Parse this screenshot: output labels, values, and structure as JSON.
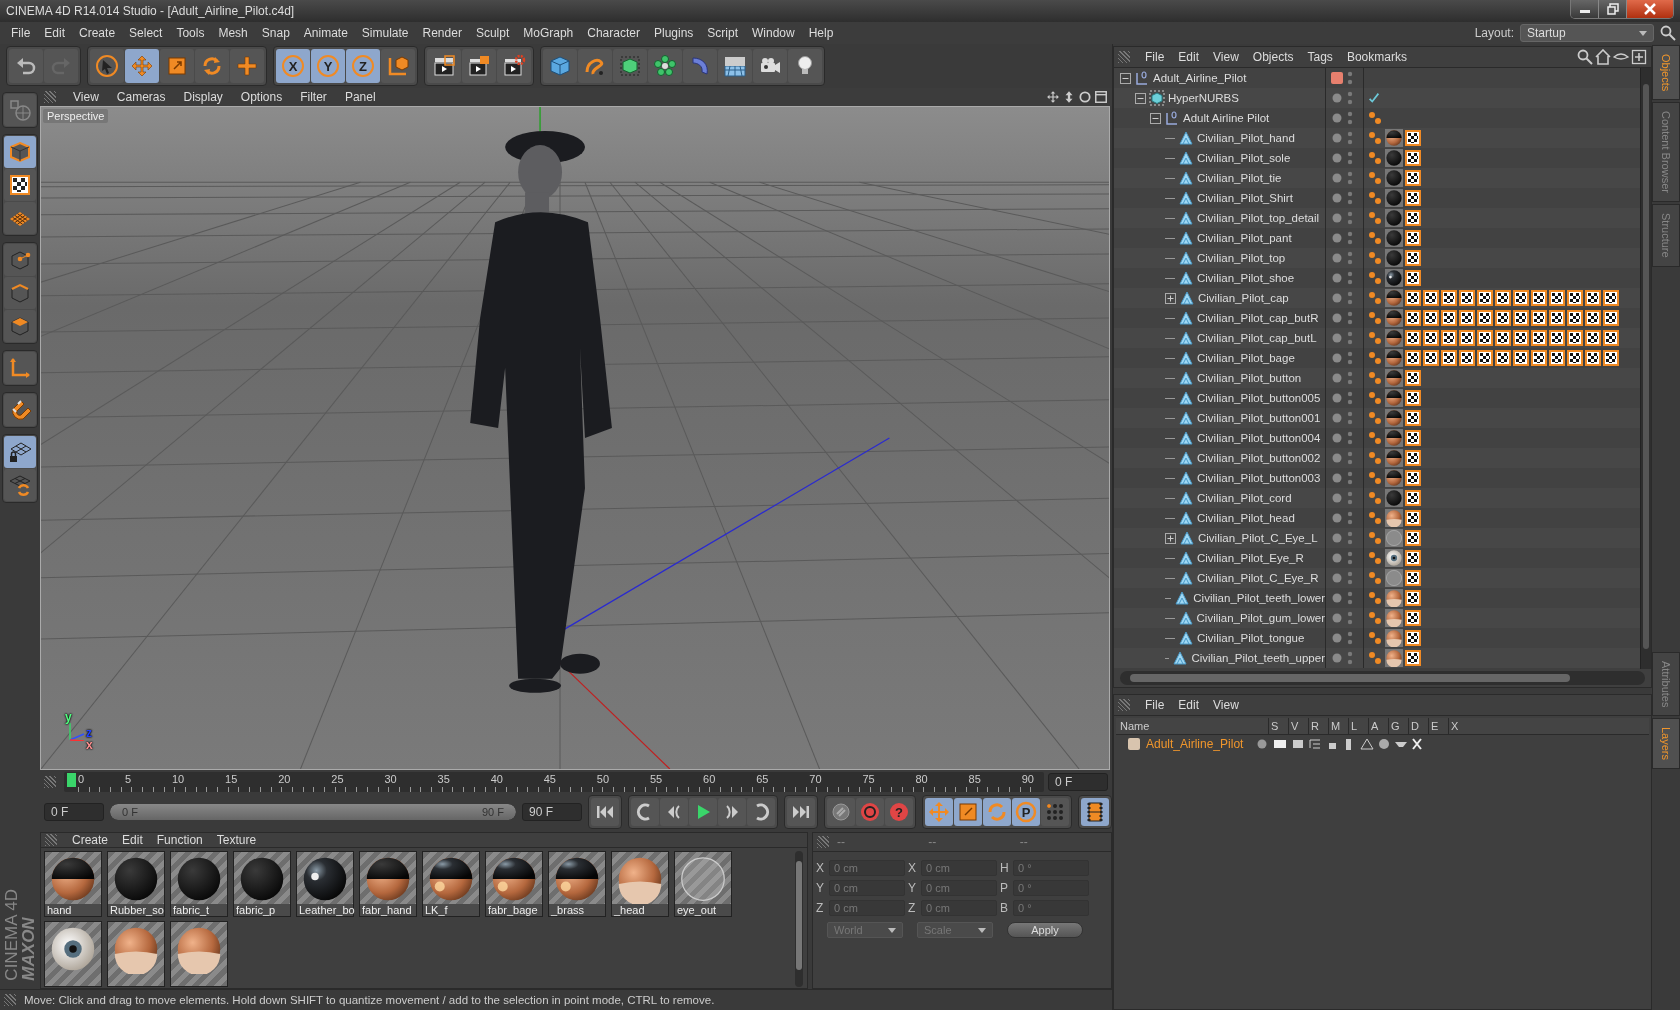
{
  "window": {
    "title": "CINEMA 4D R14.014 Studio - [Adult_Airline_Pilot.c4d]"
  },
  "menu": [
    "File",
    "Edit",
    "Create",
    "Select",
    "Tools",
    "Mesh",
    "Snap",
    "Animate",
    "Simulate",
    "Render",
    "Sculpt",
    "MoGraph",
    "Character",
    "Plugins",
    "Script",
    "Window",
    "Help"
  ],
  "layout": {
    "label": "Layout:",
    "value": "Startup"
  },
  "toolbar": [
    [
      {
        "kind": "undo",
        "selected": false
      },
      {
        "kind": "redo",
        "selected": false
      }
    ],
    [
      {
        "kind": "live-select",
        "selected": false
      },
      {
        "kind": "move",
        "selected": true
      },
      {
        "kind": "scale",
        "selected": false
      },
      {
        "kind": "rotate",
        "selected": false
      },
      {
        "kind": "add",
        "selected": false
      }
    ],
    [
      {
        "kind": "axis-lock",
        "label": "X",
        "selected": true
      },
      {
        "kind": "axis-lock",
        "label": "Y",
        "selected": true
      },
      {
        "kind": "axis-lock",
        "label": "Z",
        "selected": true
      },
      {
        "kind": "world",
        "selected": false
      }
    ],
    [
      {
        "kind": "render-view",
        "selected": false
      },
      {
        "kind": "render-picture",
        "selected": false
      },
      {
        "kind": "render-settings",
        "selected": false
      }
    ],
    [
      {
        "kind": "cube",
        "selected": false
      },
      {
        "kind": "spline",
        "selected": false
      },
      {
        "kind": "nurbs",
        "selected": false
      },
      {
        "kind": "cloner",
        "selected": false
      },
      {
        "kind": "deformer",
        "selected": false
      },
      {
        "kind": "floor",
        "selected": false
      },
      {
        "kind": "camera",
        "selected": false
      },
      {
        "kind": "light",
        "selected": false
      }
    ]
  ],
  "left_toolbar": [
    [
      {
        "kind": "make-editable",
        "selected": false
      }
    ],
    [
      {
        "kind": "model",
        "selected": true
      },
      {
        "kind": "texture",
        "selected": false
      },
      {
        "kind": "workplane",
        "selected": false
      }
    ],
    [
      {
        "kind": "points",
        "selected": false
      },
      {
        "kind": "edges",
        "selected": false
      },
      {
        "kind": "polygons",
        "selected": false
      }
    ],
    [
      {
        "kind": "axis",
        "selected": false
      }
    ],
    [
      {
        "kind": "magnet",
        "selected": false
      }
    ],
    [
      {
        "kind": "lock-grid",
        "selected": true
      },
      {
        "kind": "sync-grid",
        "selected": false
      }
    ]
  ],
  "branding": {
    "brand": "MAXON",
    "product": "CINEMA 4D"
  },
  "viewport": {
    "menu": [
      "View",
      "Cameras",
      "Display",
      "Options",
      "Filter",
      "Panel"
    ],
    "label": "Perspective",
    "gizmo_labels": [
      "y",
      "z",
      "x"
    ]
  },
  "timeline": {
    "ticks": [
      "0",
      "5",
      "10",
      "15",
      "20",
      "25",
      "30",
      "35",
      "40",
      "45",
      "50",
      "55",
      "60",
      "65",
      "70",
      "75",
      "80",
      "85",
      "90"
    ],
    "current_frame": "0 F"
  },
  "transport": {
    "start_field": "0 F",
    "range_start": "0 F",
    "range_end": "90 F",
    "level": 1,
    "end_field": "90 F",
    "buttons": [
      [
        {
          "kind": "first",
          "selected": false
        }
      ],
      [
        {
          "kind": "loop-back",
          "selected": false
        },
        {
          "kind": "prev-key",
          "selected": false
        },
        {
          "kind": "play",
          "selected": false
        },
        {
          "kind": "next-key",
          "selected": false
        },
        {
          "kind": "loop-forward",
          "selected": false
        }
      ],
      [
        {
          "kind": "last",
          "selected": false
        }
      ],
      [
        {
          "kind": "record",
          "selected": false
        },
        {
          "kind": "autokey",
          "selected": false
        },
        {
          "kind": "help-key",
          "label": "?",
          "selected": false
        }
      ],
      [
        {
          "kind": "key-move",
          "selected": true
        },
        {
          "kind": "key-scale",
          "selected": true
        },
        {
          "kind": "key-rotate",
          "selected": true
        },
        {
          "kind": "key-param",
          "label": "P",
          "selected": true
        },
        {
          "kind": "key-pla",
          "selected": false
        }
      ],
      [
        {
          "kind": "timeline-window",
          "selected": true
        }
      ]
    ]
  },
  "materials": {
    "menu": [
      "Create",
      "Edit",
      "Function",
      "Texture"
    ],
    "items": [
      {
        "name": "hand",
        "kind": "split"
      },
      {
        "name": "Rubber_so",
        "kind": "black"
      },
      {
        "name": "fabric_t",
        "kind": "black"
      },
      {
        "name": "fabric_p",
        "kind": "black"
      },
      {
        "name": "Leather_bo",
        "kind": "glossy"
      },
      {
        "name": "fabr_hand",
        "kind": "split"
      },
      {
        "name": "LK_f",
        "kind": "split-glossy"
      },
      {
        "name": "fabr_bage",
        "kind": "split-glossy"
      },
      {
        "name": "_brass",
        "kind": "split-glossy"
      },
      {
        "name": "_head",
        "kind": "skin"
      },
      {
        "name": "eye_out",
        "kind": "glass"
      },
      {
        "kind": "eye"
      },
      {
        "kind": "skin"
      },
      {
        "kind": "skin"
      }
    ]
  },
  "coordinates": {
    "headers": [
      "--",
      "--",
      "--"
    ],
    "rows": [
      {
        "pos_axis": "X",
        "position": "0 cm",
        "size_axis": "X",
        "size": "0 cm",
        "rot_axis": "H",
        "rotation": "0 °"
      },
      {
        "pos_axis": "Y",
        "position": "0 cm",
        "size_axis": "Y",
        "size": "0 cm",
        "rot_axis": "P",
        "rotation": "0 °"
      },
      {
        "pos_axis": "Z",
        "position": "0 cm",
        "size_axis": "Z",
        "size": "0 cm",
        "rot_axis": "B",
        "rotation": "0 °"
      }
    ],
    "mode": "World",
    "size_mode": "Scale",
    "apply": "Apply"
  },
  "status_bar": "Move: Click and drag to move elements. Hold down SHIFT to quantize movement / add to the selection in point mode, CTRL to remove.",
  "object_manager": {
    "menu": [
      "File",
      "Edit",
      "View",
      "Objects",
      "Tags",
      "Bookmarks"
    ],
    "objects": [
      {
        "name": "Adult_Airline_Pilot",
        "kind": "null",
        "expanded": true,
        "color": "#e8806e",
        "children": [
          {
            "name": "HyperNURBS",
            "kind": "hypernurbs",
            "expanded": true,
            "tags": [
              {
                "kind": "check"
              }
            ],
            "children": [
              {
                "name": "Adult Airline Pilot",
                "kind": "null",
                "expanded": true,
                "tags": [
                  {
                    "kind": "phong"
                  }
                ],
                "children": [
                  {
                    "name": "Civilian_Pilot_hand",
                    "kind": "polygon",
                    "tags": [
                      {
                        "kind": "phong"
                      },
                      {
                        "kind": "mat-split"
                      },
                      {
                        "kind": "texture"
                      }
                    ]
                  },
                  {
                    "name": "Civilian_Pilot_sole",
                    "kind": "polygon",
                    "tags": [
                      {
                        "kind": "phong"
                      },
                      {
                        "kind": "mat-black"
                      },
                      {
                        "kind": "texture"
                      }
                    ]
                  },
                  {
                    "name": "Civilian_Pilot_tie",
                    "kind": "polygon",
                    "tags": [
                      {
                        "kind": "phong"
                      },
                      {
                        "kind": "mat-black"
                      },
                      {
                        "kind": "texture"
                      }
                    ]
                  },
                  {
                    "name": "Civilian_Pilot_Shirt",
                    "kind": "polygon",
                    "tags": [
                      {
                        "kind": "phong"
                      },
                      {
                        "kind": "mat-black"
                      },
                      {
                        "kind": "texture"
                      }
                    ]
                  },
                  {
                    "name": "Civilian_Pilot_top_detail",
                    "kind": "polygon",
                    "tags": [
                      {
                        "kind": "phong"
                      },
                      {
                        "kind": "mat-black"
                      },
                      {
                        "kind": "texture"
                      }
                    ]
                  },
                  {
                    "name": "Civilian_Pilot_pant",
                    "kind": "polygon",
                    "tags": [
                      {
                        "kind": "phong"
                      },
                      {
                        "kind": "mat-black"
                      },
                      {
                        "kind": "texture"
                      }
                    ]
                  },
                  {
                    "name": "Civilian_Pilot_top",
                    "kind": "polygon",
                    "tags": [
                      {
                        "kind": "phong"
                      },
                      {
                        "kind": "mat-black"
                      },
                      {
                        "kind": "texture"
                      }
                    ]
                  },
                  {
                    "name": "Civilian_Pilot_shoe",
                    "kind": "polygon",
                    "tags": [
                      {
                        "kind": "phong"
                      },
                      {
                        "kind": "mat-glossy"
                      },
                      {
                        "kind": "texture"
                      }
                    ]
                  },
                  {
                    "name": "Civilian_Pilot_cap",
                    "kind": "polygon",
                    "expanded": false,
                    "tags": [
                      {
                        "kind": "phong"
                      },
                      {
                        "kind": "mat-split"
                      },
                      {
                        "kind": "texture"
                      },
                      {
                        "kind": "texture"
                      },
                      {
                        "kind": "texture"
                      },
                      {
                        "kind": "texture"
                      },
                      {
                        "kind": "texture"
                      },
                      {
                        "kind": "texture"
                      },
                      {
                        "kind": "texture"
                      },
                      {
                        "kind": "texture"
                      },
                      {
                        "kind": "texture"
                      },
                      {
                        "kind": "texture"
                      },
                      {
                        "kind": "texture"
                      },
                      {
                        "kind": "texture"
                      }
                    ]
                  },
                  {
                    "name": "Civilian_Pilot_cap_butR",
                    "kind": "polygon",
                    "tags": [
                      {
                        "kind": "phong"
                      },
                      {
                        "kind": "mat-split"
                      },
                      {
                        "kind": "texture"
                      },
                      {
                        "kind": "texture"
                      },
                      {
                        "kind": "texture"
                      },
                      {
                        "kind": "texture"
                      },
                      {
                        "kind": "texture"
                      },
                      {
                        "kind": "texture"
                      },
                      {
                        "kind": "texture"
                      },
                      {
                        "kind": "texture"
                      },
                      {
                        "kind": "texture"
                      },
                      {
                        "kind": "texture"
                      },
                      {
                        "kind": "texture"
                      },
                      {
                        "kind": "texture"
                      }
                    ]
                  },
                  {
                    "name": "Civilian_Pilot_cap_butL",
                    "kind": "polygon",
                    "tags": [
                      {
                        "kind": "phong"
                      },
                      {
                        "kind": "mat-split"
                      },
                      {
                        "kind": "texture"
                      },
                      {
                        "kind": "texture"
                      },
                      {
                        "kind": "texture"
                      },
                      {
                        "kind": "texture"
                      },
                      {
                        "kind": "texture"
                      },
                      {
                        "kind": "texture"
                      },
                      {
                        "kind": "texture"
                      },
                      {
                        "kind": "texture"
                      },
                      {
                        "kind": "texture"
                      },
                      {
                        "kind": "texture"
                      },
                      {
                        "kind": "texture"
                      },
                      {
                        "kind": "texture"
                      }
                    ]
                  },
                  {
                    "name": "Civilian_Pilot_bage",
                    "kind": "polygon",
                    "tags": [
                      {
                        "kind": "phong"
                      },
                      {
                        "kind": "mat-split"
                      },
                      {
                        "kind": "texture"
                      },
                      {
                        "kind": "texture"
                      },
                      {
                        "kind": "texture"
                      },
                      {
                        "kind": "texture"
                      },
                      {
                        "kind": "texture"
                      },
                      {
                        "kind": "texture"
                      },
                      {
                        "kind": "texture"
                      },
                      {
                        "kind": "texture"
                      },
                      {
                        "kind": "texture"
                      },
                      {
                        "kind": "texture"
                      },
                      {
                        "kind": "texture"
                      },
                      {
                        "kind": "texture"
                      }
                    ]
                  },
                  {
                    "name": "Civilian_Pilot_button",
                    "kind": "polygon",
                    "tags": [
                      {
                        "kind": "phong"
                      },
                      {
                        "kind": "mat-split"
                      },
                      {
                        "kind": "texture"
                      }
                    ]
                  },
                  {
                    "name": "Civilian_Pilot_button005",
                    "kind": "polygon",
                    "tags": [
                      {
                        "kind": "phong"
                      },
                      {
                        "kind": "mat-split"
                      },
                      {
                        "kind": "texture"
                      }
                    ]
                  },
                  {
                    "name": "Civilian_Pilot_button001",
                    "kind": "polygon",
                    "tags": [
                      {
                        "kind": "phong"
                      },
                      {
                        "kind": "mat-split"
                      },
                      {
                        "kind": "texture"
                      }
                    ]
                  },
                  {
                    "name": "Civilian_Pilot_button004",
                    "kind": "polygon",
                    "tags": [
                      {
                        "kind": "phong"
                      },
                      {
                        "kind": "mat-split"
                      },
                      {
                        "kind": "texture"
                      }
                    ]
                  },
                  {
                    "name": "Civilian_Pilot_button002",
                    "kind": "polygon",
                    "tags": [
                      {
                        "kind": "phong"
                      },
                      {
                        "kind": "mat-split"
                      },
                      {
                        "kind": "texture"
                      }
                    ]
                  },
                  {
                    "name": "Civilian_Pilot_button003",
                    "kind": "polygon",
                    "tags": [
                      {
                        "kind": "phong"
                      },
                      {
                        "kind": "mat-split"
                      },
                      {
                        "kind": "texture"
                      }
                    ]
                  },
                  {
                    "name": "Civilian_Pilot_cord",
                    "kind": "polygon",
                    "tags": [
                      {
                        "kind": "phong"
                      },
                      {
                        "kind": "mat-black"
                      },
                      {
                        "kind": "texture"
                      }
                    ]
                  },
                  {
                    "name": "Civilian_Pilot_head",
                    "kind": "polygon",
                    "tags": [
                      {
                        "kind": "phong"
                      },
                      {
                        "kind": "mat-skin"
                      },
                      {
                        "kind": "texture"
                      }
                    ]
                  },
                  {
                    "name": "Civilian_Pilot_C_Eye_L",
                    "kind": "polygon",
                    "expanded": false,
                    "tags": [
                      {
                        "kind": "phong"
                      },
                      {
                        "kind": "mat-glass"
                      },
                      {
                        "kind": "texture"
                      }
                    ]
                  },
                  {
                    "name": "Civilian_Pilot_Eye_R",
                    "kind": "polygon",
                    "tags": [
                      {
                        "kind": "phong"
                      },
                      {
                        "kind": "mat-eye"
                      },
                      {
                        "kind": "texture"
                      }
                    ]
                  },
                  {
                    "name": "Civilian_Pilot_C_Eye_R",
                    "kind": "polygon",
                    "tags": [
                      {
                        "kind": "phong"
                      },
                      {
                        "kind": "mat-glass"
                      },
                      {
                        "kind": "texture"
                      }
                    ]
                  },
                  {
                    "name": "Civilian_Pilot_teeth_lower",
                    "kind": "polygon",
                    "tags": [
                      {
                        "kind": "phong"
                      },
                      {
                        "kind": "mat-skin"
                      },
                      {
                        "kind": "texture"
                      }
                    ]
                  },
                  {
                    "name": "Civilian_Pilot_gum_lower",
                    "kind": "polygon",
                    "tags": [
                      {
                        "kind": "phong"
                      },
                      {
                        "kind": "mat-skin"
                      },
                      {
                        "kind": "texture"
                      }
                    ]
                  },
                  {
                    "name": "Civilian_Pilot_tongue",
                    "kind": "polygon",
                    "tags": [
                      {
                        "kind": "phong"
                      },
                      {
                        "kind": "mat-skin"
                      },
                      {
                        "kind": "texture"
                      }
                    ]
                  },
                  {
                    "name": "Civilian_Pilot_teeth_upper",
                    "kind": "polygon",
                    "tags": [
                      {
                        "kind": "phong"
                      },
                      {
                        "kind": "mat-skin"
                      },
                      {
                        "kind": "texture"
                      }
                    ]
                  }
                ]
              }
            ]
          }
        ]
      }
    ]
  },
  "side_tabs_top": [
    {
      "label": "Objects",
      "selected": true
    },
    {
      "label": "Content Browser",
      "selected": false
    },
    {
      "label": "Structure",
      "selected": false
    }
  ],
  "layer_manager": {
    "menu": [
      "File",
      "Edit",
      "View"
    ],
    "columns": [
      "Name",
      "S",
      "V",
      "R",
      "M",
      "L",
      "A",
      "G",
      "D",
      "E",
      "X"
    ],
    "layers": [
      {
        "name": "Adult_Airline_Pilot",
        "color": "#d8c4ae"
      }
    ]
  },
  "side_tabs_bottom": [
    {
      "label": "Attributes",
      "selected": false
    },
    {
      "label": "Layers",
      "selected": true
    }
  ]
}
